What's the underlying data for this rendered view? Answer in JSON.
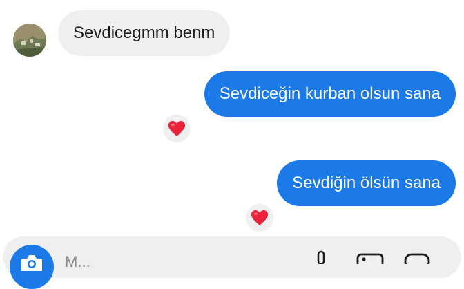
{
  "messages": [
    {
      "direction": "incoming",
      "text": "Sevdicegmm benm"
    },
    {
      "direction": "outgoing",
      "text": "Sevdiceğin kurban olsun sana",
      "reaction": "❤️"
    },
    {
      "direction": "outgoing",
      "text": "Sevdiğin ölsün sana",
      "reaction": "❤️"
    }
  ],
  "composer": {
    "placeholder": "M...",
    "icons": [
      "camera-icon",
      "microphone-icon",
      "gallery-icon",
      "sticker-icon"
    ]
  },
  "colors": {
    "outgoing_bubble": "#1b7ae8",
    "incoming_bubble": "#efeff0",
    "reaction_heart": "#e8233a"
  }
}
